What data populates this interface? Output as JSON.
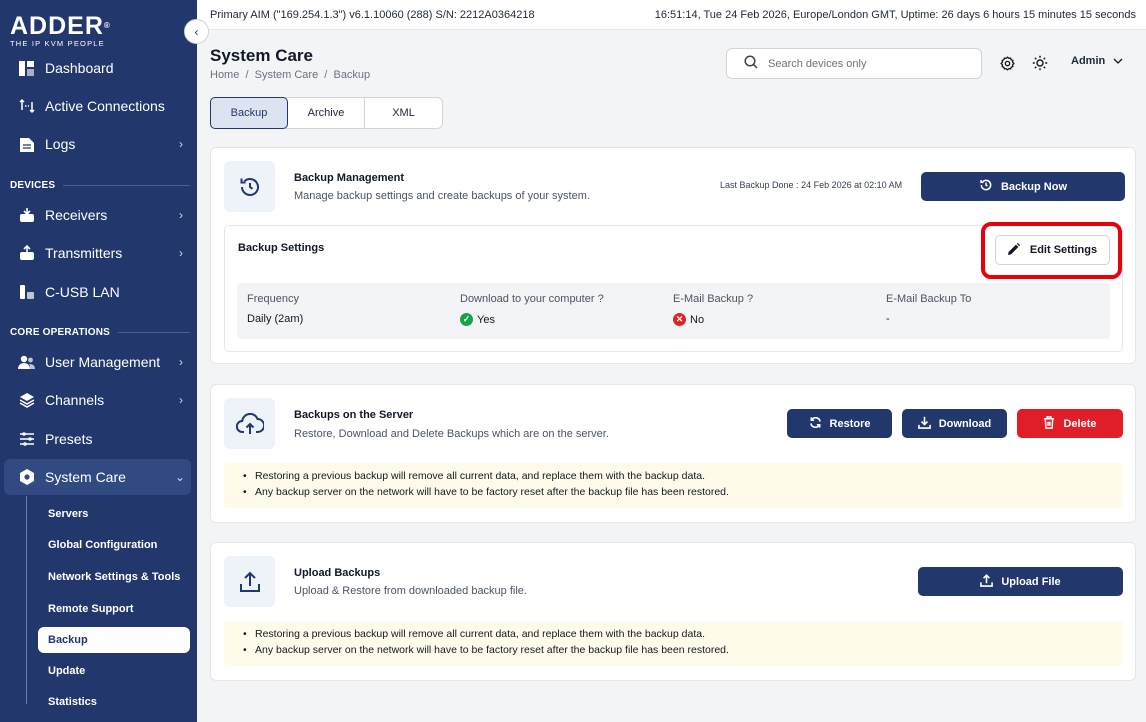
{
  "brand": {
    "name": "ADDER",
    "mark": "®",
    "tagline": "THE IP KVM PEOPLE"
  },
  "status_bar": {
    "left": "Primary AIM (\"169.254.1.3\") v6.1.10060 (288) S/N: 2212A0364218",
    "right": "16:51:14, Tue 24 Feb 2026, Europe/London GMT, Uptime: 26 days 6 hours 15 minutes 15 seconds"
  },
  "sidebar": {
    "items": [
      {
        "label": "Dashboard"
      },
      {
        "label": "Active Connections"
      },
      {
        "label": "Logs"
      },
      {
        "label": "Receivers"
      },
      {
        "label": "Transmitters"
      },
      {
        "label": "C-USB LAN"
      },
      {
        "label": "User Management"
      },
      {
        "label": "Channels"
      },
      {
        "label": "Presets"
      },
      {
        "label": "System Care"
      }
    ],
    "sections": {
      "devices": "DEVICES",
      "core": "CORE OPERATIONS"
    },
    "sub_items": [
      {
        "label": "Servers"
      },
      {
        "label": "Global Configuration"
      },
      {
        "label": "Network Settings & Tools"
      },
      {
        "label": "Remote Support"
      },
      {
        "label": "Backup"
      },
      {
        "label": "Update"
      },
      {
        "label": "Statistics"
      }
    ]
  },
  "header": {
    "title": "System Care",
    "breadcrumb": "Home  /  System Care  /  Backup",
    "search_placeholder": "Search devices only",
    "user": "Admin"
  },
  "tabs": [
    {
      "label": "Backup",
      "active": true
    },
    {
      "label": "Archive"
    },
    {
      "label": "XML"
    }
  ],
  "backup_management": {
    "title": "Backup Management",
    "desc": "Manage backup settings and create backups of your system.",
    "last_backup_label": "Last Backup Done : ",
    "last_backup_value": "24 Feb 2026 at 02:10 AM",
    "backup_now": "Backup Now",
    "settings": {
      "title": "Backup Settings",
      "edit": "Edit Settings",
      "columns": [
        {
          "header": "Frequency",
          "value": "Daily (2am)"
        },
        {
          "header": "Download to your computer ?",
          "value": "Yes",
          "status": "ok"
        },
        {
          "header": "E-Mail Backup ?",
          "value": "No",
          "status": "no"
        },
        {
          "header": "E-Mail Backup To",
          "value": "-"
        }
      ]
    }
  },
  "server_backups": {
    "title": "Backups on the Server",
    "desc": "Restore, Download and Delete Backups which are on the server.",
    "restore": "Restore",
    "download": "Download",
    "delete": "Delete",
    "notes": [
      "Restoring a previous backup will remove all current data, and replace them with the backup data.",
      "Any backup server on the network will have to be factory reset after the backup file has been restored."
    ]
  },
  "upload_backups": {
    "title": "Upload Backups",
    "desc": "Upload & Restore from downloaded backup file.",
    "upload": "Upload File",
    "notes": [
      "Restoring a previous backup will remove all current data, and replace them with the backup data.",
      "Any backup server on the network will have to be factory reset after the backup file has been restored."
    ]
  },
  "colors": {
    "navy": "#22376b",
    "danger": "#e11d28",
    "highlight": "#e8000b",
    "notice_bg": "#fffbea"
  }
}
